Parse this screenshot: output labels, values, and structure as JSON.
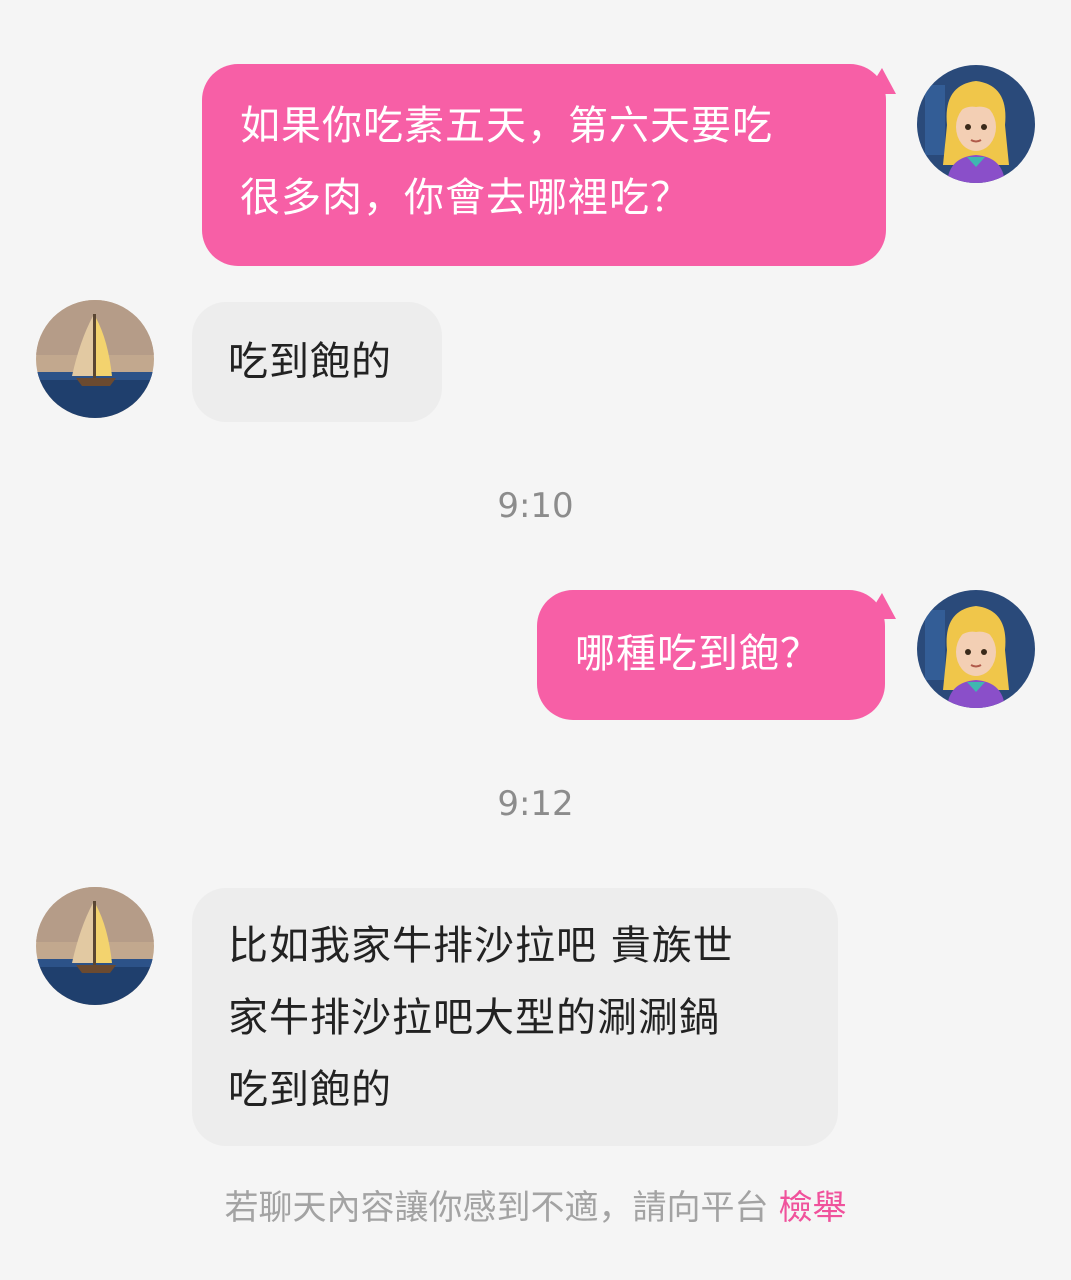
{
  "messages": [
    {
      "side": "outgoing",
      "lines": [
        "如果你吃素五天，第六天要吃",
        "很多肉，你會去哪裡吃？"
      ]
    },
    {
      "side": "incoming",
      "lines": [
        "吃到飽的"
      ]
    },
    {
      "side": "outgoing",
      "lines": [
        "哪種吃到飽？"
      ]
    },
    {
      "side": "incoming",
      "lines": [
        "比如我家牛排沙拉吧 貴族世",
        "家牛排沙拉吧大型的涮涮鍋",
        "吃到飽的"
      ]
    }
  ],
  "timestamps": [
    "9:10",
    "9:12"
  ],
  "footer": {
    "notice": "若聊天內容讓你感到不適，請向平台",
    "report_link": "檢舉"
  },
  "colors": {
    "outgoing_bubble": "#f75fa6",
    "incoming_bubble": "#ededed",
    "background": "#f5f5f5",
    "report_link": "#f0529c"
  },
  "icons": {
    "self_avatar": "girl-avatar",
    "peer_avatar": "sailboat-avatar"
  }
}
